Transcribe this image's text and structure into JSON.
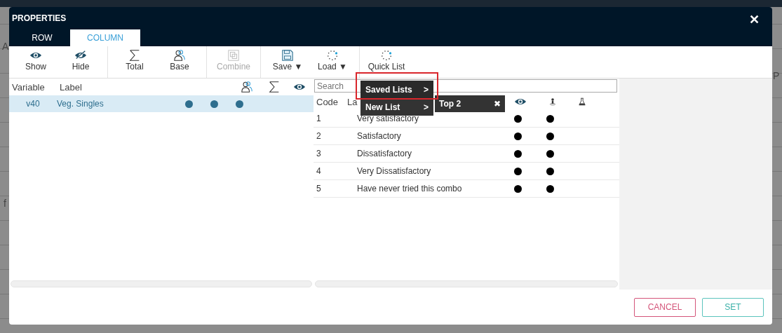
{
  "backdrop": {
    "texts": [
      "A",
      "f",
      "P"
    ]
  },
  "dialog": {
    "title": "PROPERTIES",
    "close": "✕",
    "tabs": [
      {
        "label": "ROW",
        "selected": false
      },
      {
        "label": "COLUMN",
        "selected": true
      }
    ],
    "toolbar": [
      [
        {
          "label": "Show",
          "kind": "eye",
          "disabled": false
        },
        {
          "label": "Hide",
          "kind": "eye-off",
          "disabled": false
        }
      ],
      [
        {
          "label": "Total",
          "kind": "sigma",
          "disabled": false
        },
        {
          "label": "Base",
          "kind": "people",
          "disabled": false
        }
      ],
      [
        {
          "label": "Combine",
          "kind": "combine",
          "disabled": true
        }
      ],
      [
        {
          "label": "Save ▼",
          "kind": "floppy",
          "disabled": false
        },
        {
          "label": "Load ▼",
          "kind": "dots",
          "disabled": false
        }
      ],
      [
        {
          "label": "Quick List",
          "kind": "dots",
          "disabled": false
        }
      ]
    ],
    "variables": {
      "columns": [
        {
          "label": "Variable",
          "kind": "text"
        },
        {
          "label": "Label",
          "kind": "text"
        },
        {
          "kind": "people"
        },
        {
          "kind": "sigma"
        },
        {
          "kind": "eye"
        }
      ],
      "rows": [
        {
          "variable": "v40",
          "label": "Veg. Singles",
          "selected": true,
          "base": true,
          "total": true,
          "shown": true
        }
      ]
    },
    "codes": {
      "search": {
        "placeholder": "Search"
      },
      "columns": [
        {
          "label": "Code",
          "kind": "text"
        },
        {
          "label": "La",
          "kind": "text"
        },
        {
          "kind": "eye"
        },
        {
          "kind": "person"
        },
        {
          "kind": "flask"
        }
      ],
      "rows": [
        {
          "code": "1",
          "label": "Very satisfactory",
          "shown": true,
          "person": true,
          "flask": false
        },
        {
          "code": "2",
          "label": "Satisfactory",
          "shown": true,
          "person": true,
          "flask": false
        },
        {
          "code": "3",
          "label": "Dissatisfactory",
          "shown": true,
          "person": true,
          "flask": false
        },
        {
          "code": "4",
          "label": "Very Dissatisfactory",
          "shown": true,
          "person": true,
          "flask": false
        },
        {
          "code": "5",
          "label": "Have never tried this combo",
          "shown": true,
          "person": true,
          "flask": false
        }
      ]
    },
    "menu": {
      "items": [
        {
          "label": "Saved Lists",
          "arrow": ">",
          "highlighted": true
        },
        {
          "label": "New List",
          "arrow": ">",
          "highlighted": false
        }
      ],
      "submenu": [
        {
          "label": "Top 2",
          "remove": "✖"
        }
      ]
    },
    "buttons": [
      {
        "label": "CANCEL",
        "kind": "cancel"
      },
      {
        "label": "SET",
        "kind": "confirm"
      }
    ]
  }
}
